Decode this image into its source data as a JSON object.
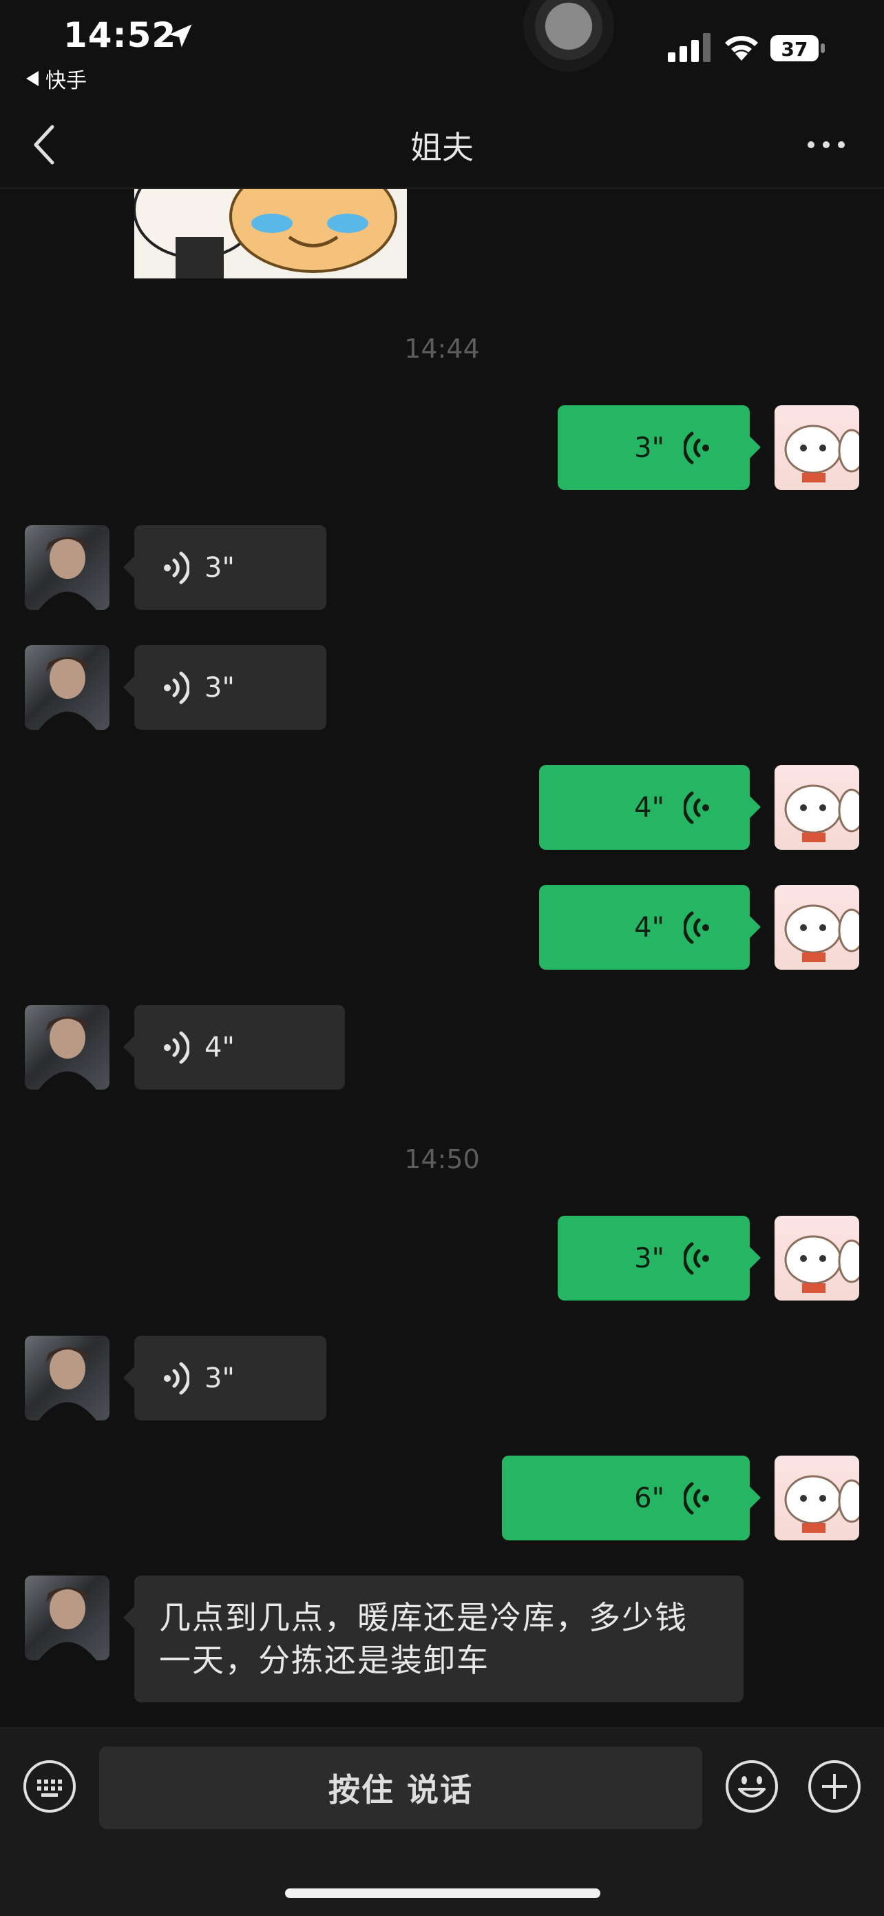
{
  "status_bar": {
    "time": "14:52",
    "back_app_label": "快手",
    "battery": "37"
  },
  "nav": {
    "title": "姐夫"
  },
  "timestamps": [
    "14:44",
    "14:50"
  ],
  "messages": [
    {
      "side": "sent",
      "duration": "3\""
    },
    {
      "side": "received",
      "duration": "3\""
    },
    {
      "side": "received",
      "duration": "3\""
    },
    {
      "side": "sent",
      "duration": "4\""
    },
    {
      "side": "sent",
      "duration": "4\""
    },
    {
      "side": "received",
      "duration": "4\""
    },
    {
      "side": "sent",
      "duration": "3\""
    },
    {
      "side": "received",
      "duration": "3\""
    },
    {
      "side": "sent",
      "duration": "6\""
    },
    {
      "side": "received",
      "text": "几点到几点，暖库还是冷库，多少钱一天，分拣还是装卸车"
    }
  ],
  "input_bar": {
    "hold_to_talk": "按住 说话"
  },
  "colors": {
    "sent_bubble": "#26b563",
    "received_bubble": "#2c2c2c",
    "background": "#111111"
  }
}
